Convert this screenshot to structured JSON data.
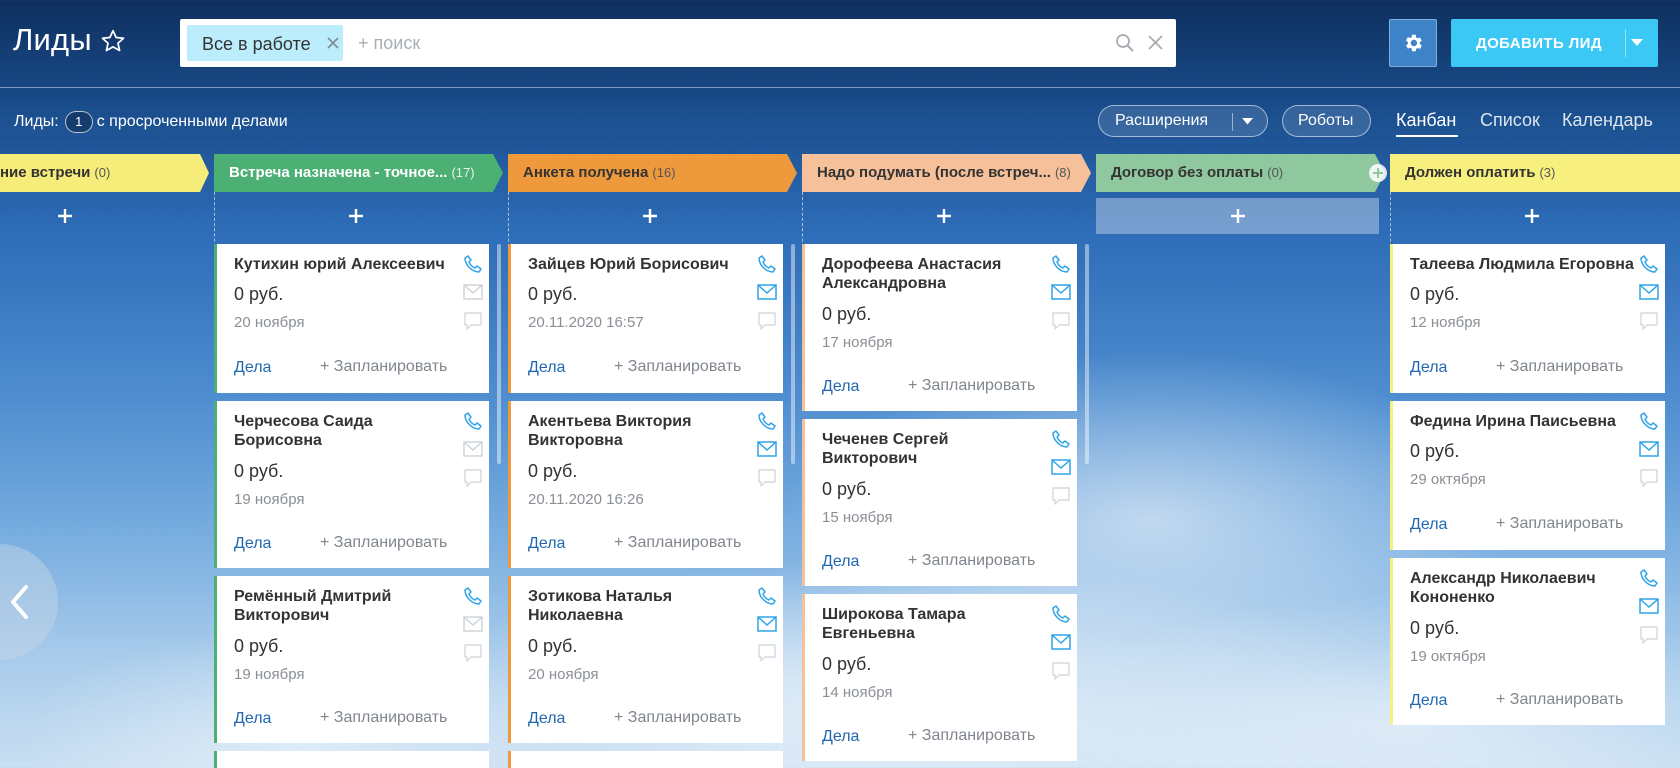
{
  "header": {
    "title": "Лиды",
    "filter_chip": "Все в работе",
    "search_placeholder": "+ поиск",
    "add_lead_label": "ДОБАВИТЬ ЛИД"
  },
  "toolbar": {
    "counter_prefix": "Лиды:",
    "counter_value": "1",
    "counter_suffix": "с просроченными делами",
    "extensions_label": "Расширения",
    "robots_label": "Роботы",
    "view_tabs": [
      "Канбан",
      "Список",
      "Календарь"
    ],
    "active_view": "Канбан"
  },
  "colors": {
    "accent": "#3bc8f5",
    "link": "#2067b0",
    "col_meeting_planned": "#f5ec7a",
    "col_meeting_set": "#4caf74",
    "col_form_received": "#ee9a3c",
    "col_think": "#f6c09a",
    "col_contract": "#8fc79e",
    "col_must_pay": "#f7ef7e"
  },
  "columns": [
    {
      "title": "ние встречи",
      "count": "(0)",
      "cards": []
    },
    {
      "title": "Встреча назначена - точное...",
      "count": "(17)",
      "cards": [
        {
          "name": "Кутихин юрий Алексеевич",
          "price": "0 руб.",
          "date": "20 ноября",
          "deals": "Дела",
          "plan": "+ Запланировать"
        },
        {
          "name": "Черчесова Саида Борисовна",
          "price": "0 руб.",
          "date": "19 ноября",
          "deals": "Дела",
          "plan": "+ Запланировать"
        },
        {
          "name": "Ремённый Дмитрий Викторович",
          "price": "0 руб.",
          "date": "19 ноября",
          "deals": "Дела",
          "plan": "+ Запланировать"
        }
      ]
    },
    {
      "title": "Анкета получена",
      "count": "(16)",
      "cards": [
        {
          "name": "Зайцев Юрий Борисович",
          "price": "0 руб.",
          "date": "20.11.2020 16:57",
          "deals": "Дела",
          "plan": "+ Запланировать"
        },
        {
          "name": "Акентьева Виктория Викторовна",
          "price": "0 руб.",
          "date": "20.11.2020 16:26",
          "deals": "Дела",
          "plan": "+ Запланировать"
        },
        {
          "name": "Зотикова Наталья Николаевна",
          "price": "0 руб.",
          "date": "20 ноября",
          "deals": "Дела",
          "plan": "+ Запланировать"
        }
      ]
    },
    {
      "title": "Надо подумать (после встреч...",
      "count": "(8)",
      "cards": [
        {
          "name": "Дорофеева Анастасия Александровна",
          "price": "0 руб.",
          "date": "17 ноября",
          "deals": "Дела",
          "plan": "+ Запланировать"
        },
        {
          "name": "Чеченев Сергей Викторович",
          "price": "0 руб.",
          "date": "15 ноября",
          "deals": "Дела",
          "plan": "+ Запланировать"
        },
        {
          "name": "Широкова Тамара Евгеньевна",
          "price": "0 руб.",
          "date": "14 ноября",
          "deals": "Дела",
          "plan": "+ Запланировать"
        }
      ]
    },
    {
      "title": "Договор без оплаты",
      "count": "(0)",
      "cards": []
    },
    {
      "title": "Должен оплатить",
      "count": "(3)",
      "cards": [
        {
          "name": "Талеева Людмила Егоровна",
          "price": "0 руб.",
          "date": "12 ноября",
          "deals": "Дела",
          "plan": "+ Запланировать"
        },
        {
          "name": "Федина Ирина Паисьевна",
          "price": "0 руб.",
          "date": "29 октября",
          "deals": "Дела",
          "plan": "+ Запланировать"
        },
        {
          "name": "Александр Николаевич Кононенко",
          "price": "0 руб.",
          "date": "19 октября",
          "deals": "Дела",
          "plan": "+ Запланировать"
        }
      ]
    }
  ]
}
